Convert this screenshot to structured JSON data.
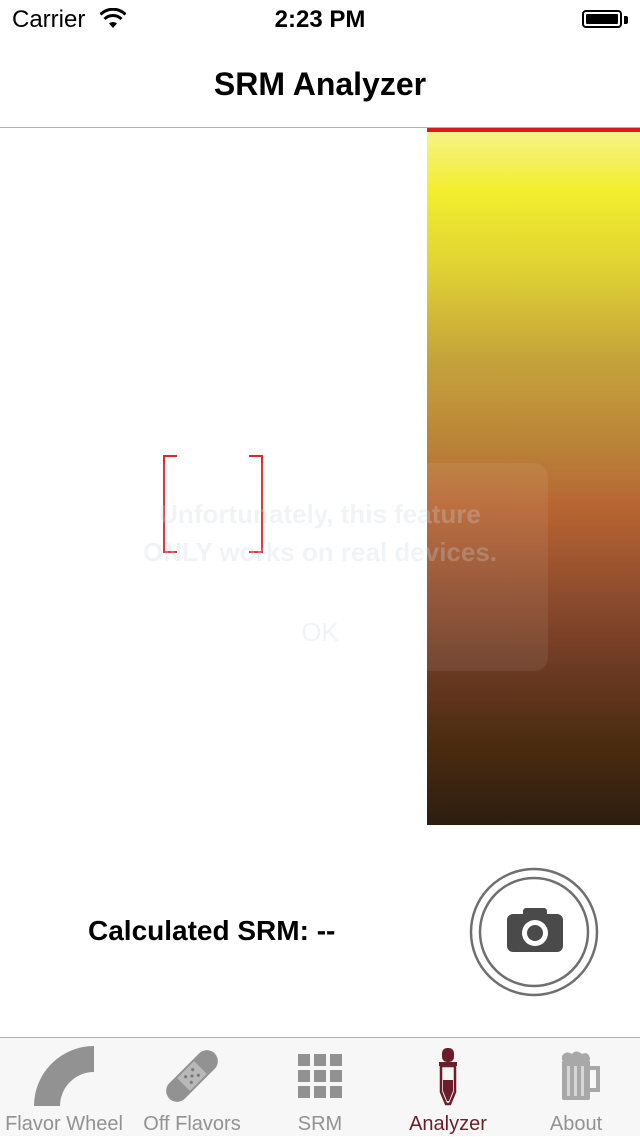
{
  "status_bar": {
    "carrier": "Carrier",
    "time": "2:23 PM"
  },
  "nav": {
    "title": "SRM Analyzer"
  },
  "alert": {
    "message_line1": "Unfortunately, this feature",
    "message_line2": "ONLY works on real devices.",
    "ok_label": "OK"
  },
  "result": {
    "label": "Calculated SRM: --"
  },
  "tabs": [
    {
      "label": "Flavor Wheel",
      "icon": "flavor-wheel-icon"
    },
    {
      "label": "Off Flavors",
      "icon": "bandage-icon"
    },
    {
      "label": "SRM",
      "icon": "grid-icon"
    },
    {
      "label": "Analyzer",
      "icon": "dropper-icon",
      "selected": true
    },
    {
      "label": "About",
      "icon": "beer-mug-icon"
    }
  ],
  "colors": {
    "accent": "#6b1e2a",
    "indicator": "#e01818",
    "tab_inactive": "#929292"
  }
}
